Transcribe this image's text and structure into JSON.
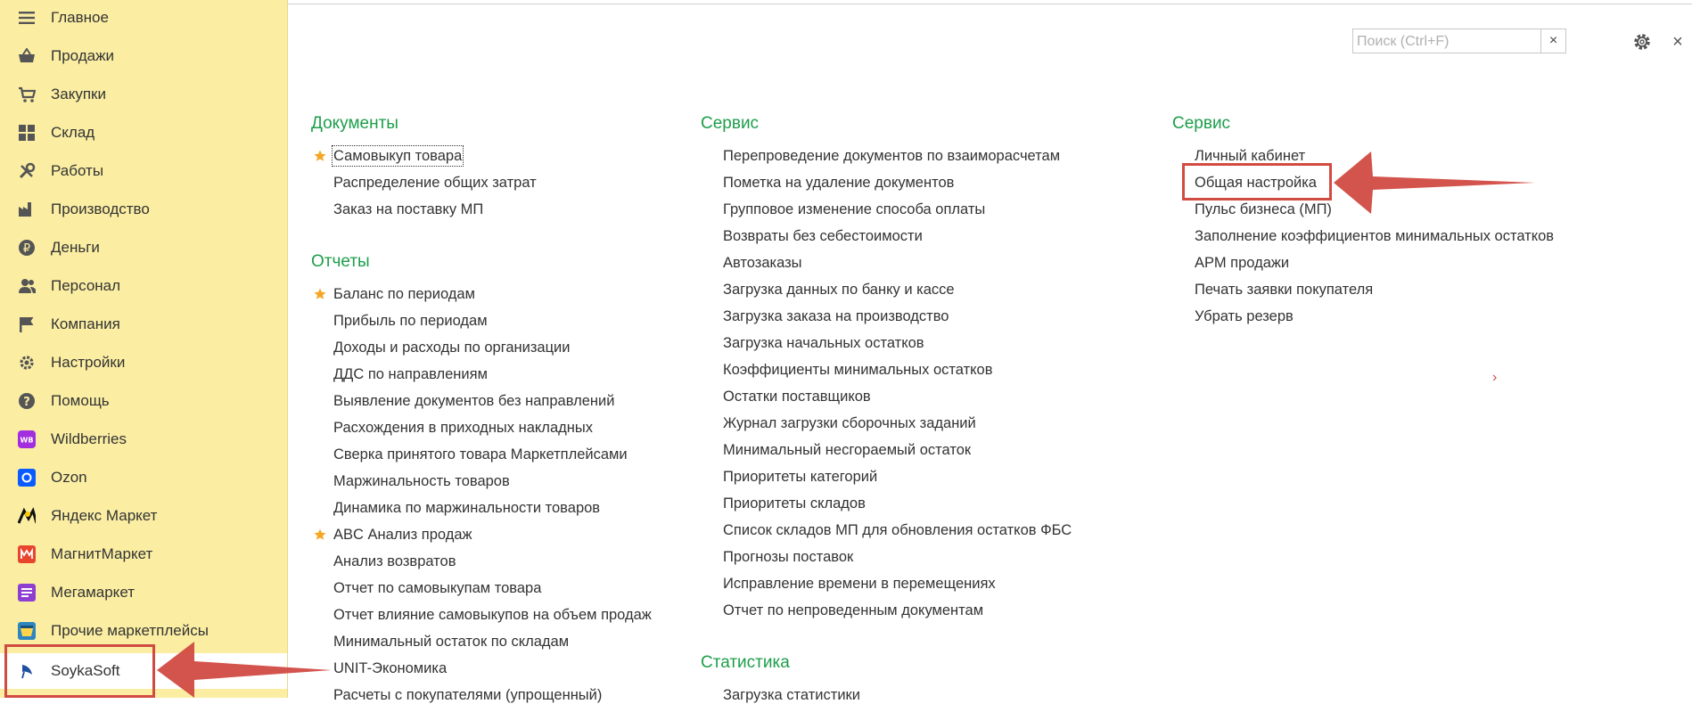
{
  "sidebar": {
    "items": [
      {
        "label": "Главное",
        "icon": "menu-lines-icon"
      },
      {
        "label": "Продажи",
        "icon": "basket-icon"
      },
      {
        "label": "Закупки",
        "icon": "cart-icon"
      },
      {
        "label": "Склад",
        "icon": "warehouse-grid-icon"
      },
      {
        "label": "Работы",
        "icon": "tools-icon"
      },
      {
        "label": "Производство",
        "icon": "factory-icon"
      },
      {
        "label": "Деньги",
        "icon": "ruble-coin-icon"
      },
      {
        "label": "Персонал",
        "icon": "people-icon"
      },
      {
        "label": "Компания",
        "icon": "flag-icon"
      },
      {
        "label": "Настройки",
        "icon": "gear-icon"
      },
      {
        "label": "Помощь",
        "icon": "question-icon"
      },
      {
        "label": "Wildberries",
        "icon": "wildberries-logo-icon"
      },
      {
        "label": "Ozon",
        "icon": "ozon-logo-icon"
      },
      {
        "label": "Яндекс Маркет",
        "icon": "yandex-market-logo-icon"
      },
      {
        "label": "МагнитМаркет",
        "icon": "magnit-logo-icon"
      },
      {
        "label": "Мегамаркет",
        "icon": "megamarket-logo-icon"
      },
      {
        "label": "Прочие маркетплейсы",
        "icon": "marketplace-icon"
      },
      {
        "label": "SoykaSoft",
        "icon": "soykasoft-logo-icon"
      }
    ]
  },
  "search": {
    "placeholder": "Поиск (Ctrl+F)",
    "value": "",
    "clear_label": "×"
  },
  "close_label": "×",
  "columns": {
    "col1": {
      "sections": [
        {
          "title": "Документы",
          "items": [
            {
              "label": "Самовыкуп товара",
              "starred": true
            },
            {
              "label": "Распределение общих затрат",
              "starred": false
            },
            {
              "label": "Заказ на поставку МП",
              "starred": false
            }
          ]
        },
        {
          "title": "Отчеты",
          "items": [
            {
              "label": "Баланс по периодам",
              "starred": true
            },
            {
              "label": "Прибыль по периодам",
              "starred": false
            },
            {
              "label": "Доходы и расходы по организации",
              "starred": false
            },
            {
              "label": "ДДС по направлениям",
              "starred": false
            },
            {
              "label": "Выявление документов без направлений",
              "starred": false
            },
            {
              "label": "Расхождения в приходных накладных",
              "starred": false
            },
            {
              "label": "Сверка принятого товара Маркетплейсами",
              "starred": false
            },
            {
              "label": "Маржинальность товаров",
              "starred": false
            },
            {
              "label": "Динамика по маржинальности товаров",
              "starred": false
            },
            {
              "label": "ABC Анализ продаж",
              "starred": true
            },
            {
              "label": "Анализ возвратов",
              "starred": false
            },
            {
              "label": "Отчет по самовыкупам товара",
              "starred": false
            },
            {
              "label": "Отчет влияние самовыкупов на объем продаж",
              "starred": false
            },
            {
              "label": "Минимальный остаток по складам",
              "starred": false
            },
            {
              "label": "UNIT-Экономика",
              "starred": false
            },
            {
              "label": "Расчеты с покупателями (упрощенный)",
              "starred": false
            }
          ]
        }
      ]
    },
    "col2": {
      "sections": [
        {
          "title": "Сервис",
          "items": [
            {
              "label": "Перепроведение документов по взаиморасчетам"
            },
            {
              "label": "Пометка на удаление документов"
            },
            {
              "label": "Групповое изменение способа оплаты"
            },
            {
              "label": "Возвраты без себестоимости"
            },
            {
              "label": "Автозаказы"
            },
            {
              "label": "Загрузка данных по банку и кассе"
            },
            {
              "label": "Загрузка заказа на производство"
            },
            {
              "label": "Загрузка начальных остатков"
            },
            {
              "label": "Коэффициенты минимальных остатков"
            },
            {
              "label": "Остатки поставщиков"
            },
            {
              "label": "Журнал загрузки сборочных заданий"
            },
            {
              "label": "Минимальный несгораемый остаток"
            },
            {
              "label": "Приоритеты категорий"
            },
            {
              "label": "Приоритеты складов"
            },
            {
              "label": "Список складов МП для обновления остатков ФБС"
            },
            {
              "label": "Прогнозы поставок"
            },
            {
              "label": "Исправление времени в перемещениях"
            },
            {
              "label": "Отчет по непроведенным документам"
            }
          ]
        },
        {
          "title": "Статистика",
          "items": [
            {
              "label": "Загрузка статистики"
            }
          ]
        }
      ]
    },
    "col3": {
      "sections": [
        {
          "title": "Сервис",
          "items": [
            {
              "label": "Личный кабинет"
            },
            {
              "label": "Общая настройка"
            },
            {
              "label": "Пульс бизнеса (МП)"
            },
            {
              "label": "Заполнение коэффициентов минимальных остатков"
            },
            {
              "label": "АРМ продажи"
            },
            {
              "label": "Печать заявки покупателя"
            },
            {
              "label": "Убрать резерв"
            }
          ]
        }
      ]
    }
  },
  "more_arrow": "›",
  "colors": {
    "accent_green": "#1d9e4a",
    "sidebar_bg": "#fbeea3",
    "annotation_red": "#d14b42",
    "star": "#f5a623"
  }
}
